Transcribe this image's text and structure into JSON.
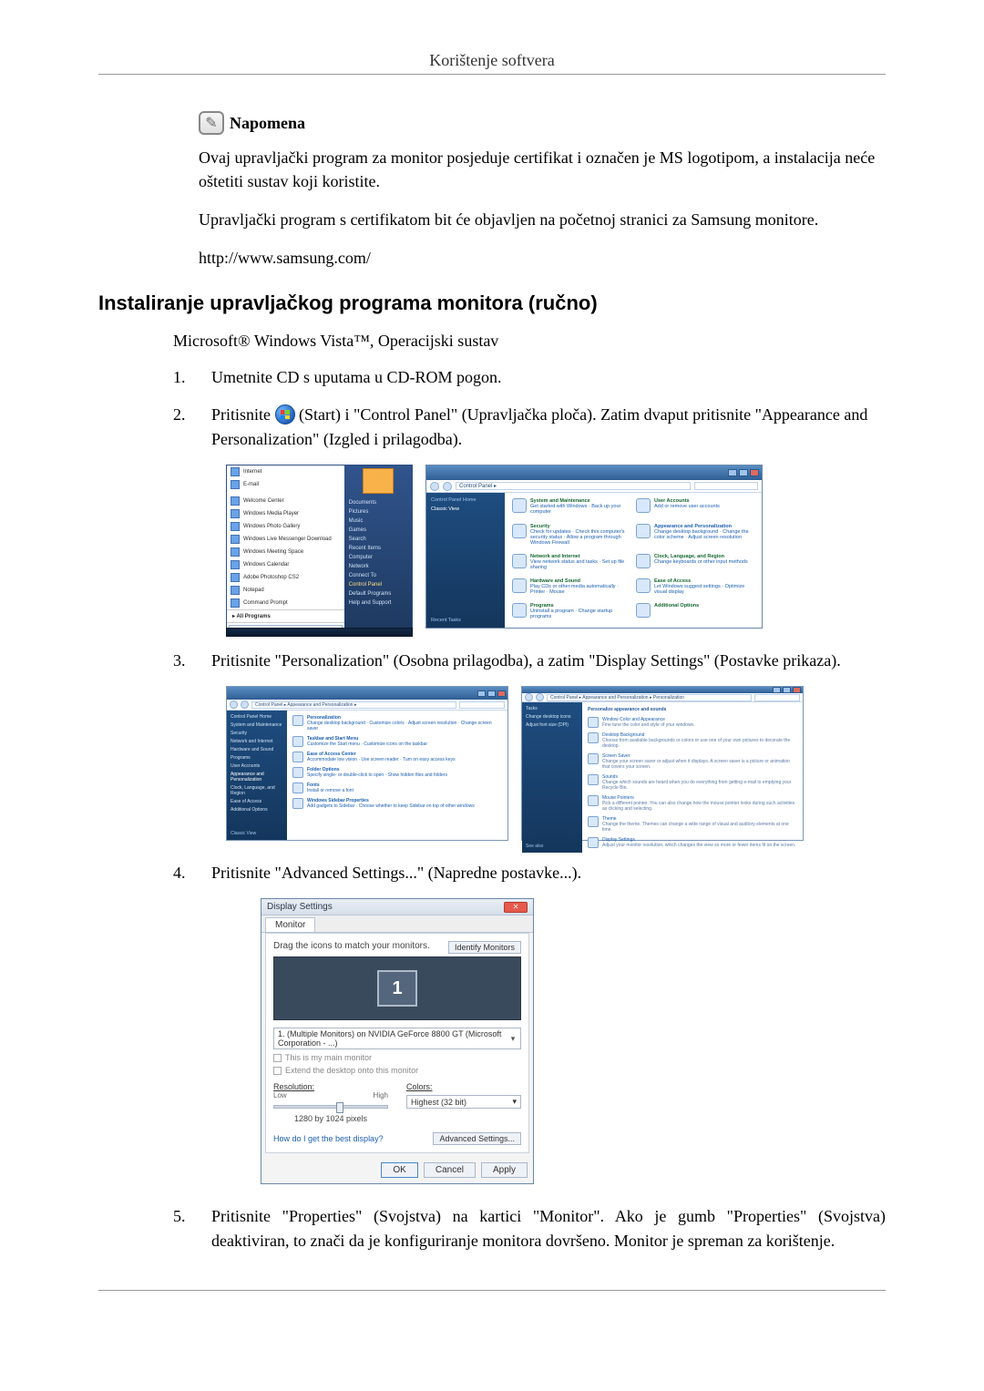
{
  "header": {
    "title": "Korištenje softvera"
  },
  "note": {
    "label": "Napomena",
    "p1": "Ovaj upravljački program za monitor posjeduje certifikat i označen je MS logotipom, a instalacija neće oštetiti sustav koji koristite.",
    "p2": "Upravljački program s certifikatom bit će objavljen na početnoj stranici za Samsung monitore.",
    "url": "http://www.samsung.com/"
  },
  "section": {
    "title": "Instaliranje upravljačkog programa monitora (ručno)",
    "sub": "Microsoft® Windows Vista™, Operacijski sustav"
  },
  "steps": {
    "s1": {
      "n": "1.",
      "t": "Umetnite CD s uputama u CD-ROM pogon."
    },
    "s2": {
      "n": "2.",
      "pre": "Pritisnite ",
      "post": "(Start) i \"Control Panel\" (Upravljačka ploča). Zatim dvaput pritisnite \"Appearance and Personalization\" (Izgled i prilagodba)."
    },
    "s3": {
      "n": "3.",
      "t": "Pritisnite \"Personalization\" (Osobna prilagodba), a zatim \"Display Settings\" (Postavke prikaza)."
    },
    "s4": {
      "n": "4.",
      "t": "Pritisnite \"Advanced Settings...\" (Napredne postavke...)."
    },
    "s5": {
      "n": "5.",
      "t": "Pritisnite \"Properties\" (Svojstva) na kartici \"Monitor\". Ako je gumb \"Properties\" (Svojstva) deaktiviran, to znači da je konfiguriranje monitora dovršeno. Monitor je spreman za korištenje."
    }
  },
  "start_menu": {
    "left": [
      "Internet",
      "E-mail",
      "Welcome Center",
      "Windows Media Player",
      "Windows Photo Gallery",
      "Windows Live Messenger Download",
      "Windows Meeting Space",
      "Windows Calendar",
      "Adobe Photoshop CS2",
      "Notepad",
      "Command Prompt"
    ],
    "all": "All Programs",
    "right": [
      "Documents",
      "Pictures",
      "Music",
      "Games",
      "Search",
      "Recent Items",
      "Computer",
      "Network",
      "Connect To",
      "Control Panel",
      "Default Programs",
      "Help and Support"
    ],
    "highlight": "Control Panel"
  },
  "cp_home": {
    "crumb": "Control Panel ▸",
    "side_head": "Control Panel Home",
    "side_link": "Classic View",
    "recent": "Recent Tasks",
    "cats": [
      {
        "t": "System and Maintenance",
        "s": "Get started with Windows · Back up your computer"
      },
      {
        "t": "User Accounts",
        "s": "Add or remove user accounts"
      },
      {
        "t": "Security",
        "s": "Check for updates · Check this computer's security status · Allow a program through Windows Firewall"
      },
      {
        "t": "Appearance and Personalization",
        "s": "Change desktop background · Change the color scheme · Adjust screen resolution"
      },
      {
        "t": "Network and Internet",
        "s": "View network status and tasks · Set up file sharing"
      },
      {
        "t": "Clock, Language, and Region",
        "s": "Change keyboards or other input methods"
      },
      {
        "t": "Hardware and Sound",
        "s": "Play CDs or other media automatically · Printer · Mouse"
      },
      {
        "t": "Ease of Access",
        "s": "Let Windows suggest settings · Optimize visual display"
      },
      {
        "t": "Programs",
        "s": "Uninstall a program · Change startup programs"
      },
      {
        "t": "Additional Options",
        "s": ""
      }
    ]
  },
  "appp": {
    "crumb": "Control Panel ▸ Appearance and Personalization ▸",
    "side": [
      "Control Panel Home",
      "System and Maintenance",
      "Security",
      "Network and Internet",
      "Hardware and Sound",
      "Programs",
      "User Accounts",
      "Appearance and Personalization",
      "Clock, Language, and Region",
      "Ease of Access",
      "Additional Options"
    ],
    "items": [
      {
        "h": "Personalization",
        "s": "Change desktop background · Customize colors · Adjust screen resolution · Change screen saver"
      },
      {
        "h": "Taskbar and Start Menu",
        "s": "Customize the Start menu · Customize icons on the taskbar"
      },
      {
        "h": "Ease of Access Center",
        "s": "Accommodate low vision · Use screen reader · Turn on easy access keys"
      },
      {
        "h": "Folder Options",
        "s": "Specify single- or double-click to open · Show hidden files and folders"
      },
      {
        "h": "Fonts",
        "s": "Install or remove a font"
      },
      {
        "h": "Windows Sidebar Properties",
        "s": "Add gadgets to Sidebar · Choose whether to keep Sidebar on top of other windows"
      }
    ],
    "seealso": "Classic View"
  },
  "pers": {
    "crumb": "Control Panel ▸ Appearance and Personalization ▸ Personalization",
    "side": [
      "Tasks",
      "Change desktop icons",
      "Adjust font size (DPI)"
    ],
    "head": "Personalize appearance and sounds",
    "items": [
      {
        "h": "Window Color and Appearance",
        "s": "Fine tune the color and style of your windows."
      },
      {
        "h": "Desktop Background",
        "s": "Choose from available backgrounds or colors or use one of your own pictures to decorate the desktop."
      },
      {
        "h": "Screen Saver",
        "s": "Change your screen saver or adjust when it displays. A screen saver is a picture or animation that covers your screen."
      },
      {
        "h": "Sounds",
        "s": "Change which sounds are heard when you do everything from getting e-mail to emptying your Recycle Bin."
      },
      {
        "h": "Mouse Pointers",
        "s": "Pick a different pointer. You can also change how the mouse pointer looks during such activities as clicking and selecting."
      },
      {
        "h": "Theme",
        "s": "Change the theme. Themes can change a wide range of visual and auditory elements at one time."
      },
      {
        "h": "Display Settings",
        "s": "Adjust your monitor resolution, which changes the view so more or fewer items fit on the screen."
      }
    ],
    "seealso": "See also"
  },
  "display_settings": {
    "title": "Display Settings",
    "tab": "Monitor",
    "drag": "Drag the icons to match your monitors.",
    "identify": "Identify Monitors",
    "monnum": "1",
    "combo": "1. (Multiple Monitors) on NVIDIA GeForce 8800 GT (Microsoft Corporation - ...)",
    "chk1": "This is my main monitor",
    "chk2": "Extend the desktop onto this monitor",
    "res_label": "Resolution:",
    "low": "Low",
    "high": "High",
    "res_value": "1280 by 1024 pixels",
    "colors_label": "Colors:",
    "colors_value": "Highest (32 bit)",
    "help_link": "How do I get the best display?",
    "adv_btn": "Advanced Settings...",
    "ok": "OK",
    "cancel": "Cancel",
    "apply": "Apply"
  }
}
